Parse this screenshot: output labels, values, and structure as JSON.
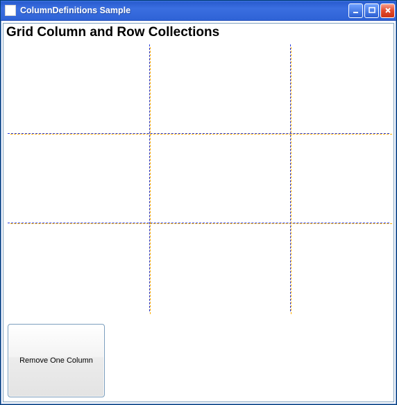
{
  "window": {
    "title": "ColumnDefinitions Sample"
  },
  "content": {
    "heading": "Grid Column and Row Collections",
    "grid": {
      "columns": 3,
      "rows": 3
    },
    "buttons": {
      "remove_column": "Remove One Column"
    }
  }
}
